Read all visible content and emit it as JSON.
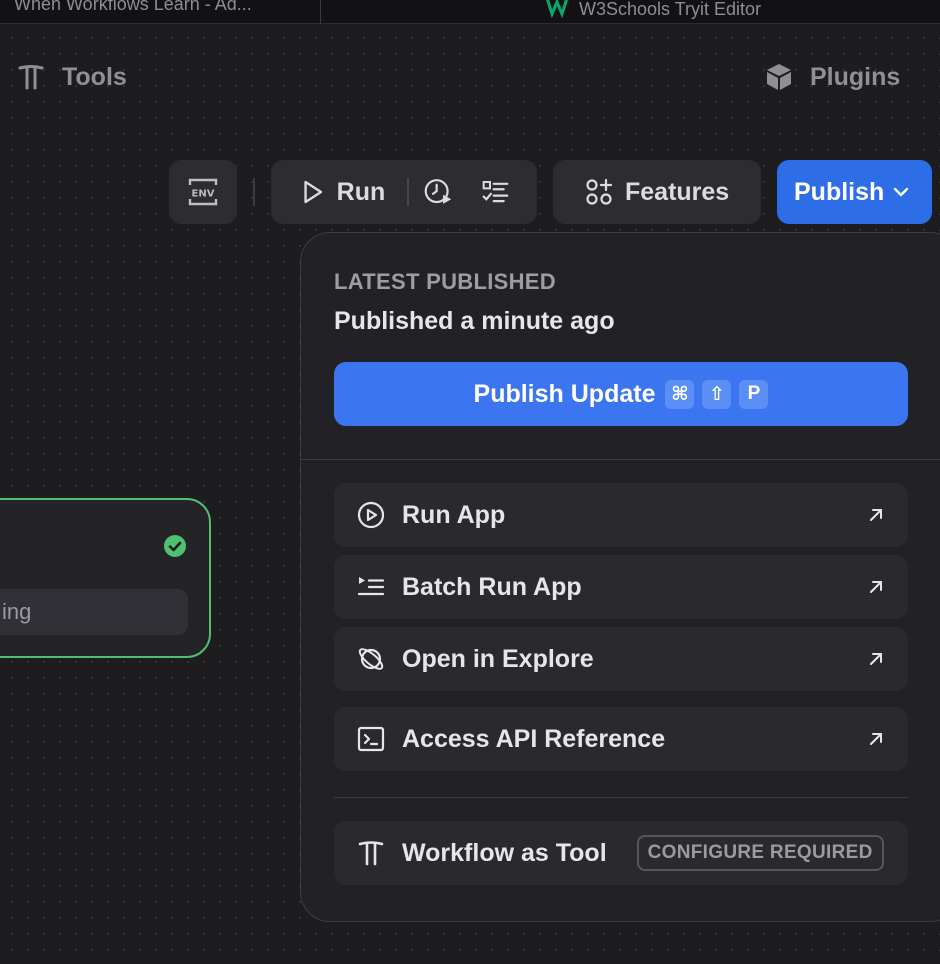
{
  "browser": {
    "tabs": [
      {
        "title": "When Workflows Learn - Ad..."
      },
      {
        "title": "W3Schools Tryit Editor",
        "icon": "w3schools-icon"
      }
    ]
  },
  "topnav": {
    "tools_label": "Tools",
    "plugins_label": "Plugins"
  },
  "toolbar": {
    "env_icon": "env-icon",
    "run_label": "Run",
    "features_label": "Features",
    "publish_label": "Publish"
  },
  "node": {
    "field_text": "ing",
    "status": "success"
  },
  "publish_menu": {
    "heading": "LATEST PUBLISHED",
    "subheading": "Published a minute ago",
    "publish_update_label": "Publish Update",
    "shortcut_keys": [
      "⌘",
      "⇧",
      "P"
    ],
    "items": [
      {
        "label": "Run App",
        "icon": "play-circle-icon"
      },
      {
        "label": "Batch Run App",
        "icon": "batch-list-icon"
      },
      {
        "label": "Open in Explore",
        "icon": "planet-icon"
      },
      {
        "label": "Access API Reference",
        "icon": "terminal-icon"
      }
    ],
    "tool_item": {
      "label": "Workflow as Tool",
      "badge": "CONFIGURE REQUIRED"
    }
  },
  "colors": {
    "accent": "#2e6de8",
    "panel_bg": "#222226",
    "success": "#4fbf72"
  }
}
